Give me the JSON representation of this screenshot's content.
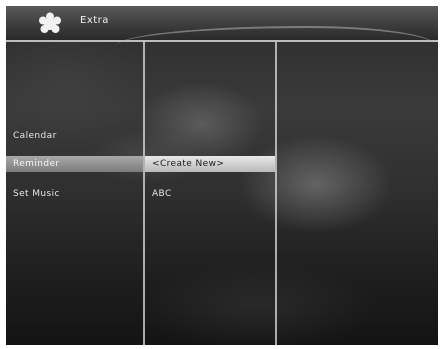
{
  "header": {
    "title": "Extra",
    "logo_icon": "flower-logo-icon"
  },
  "menu_column_1": {
    "items": [
      {
        "label": "Calendar",
        "selected": false
      },
      {
        "label": "Reminder",
        "selected": true
      },
      {
        "label": "Set Music",
        "selected": false
      }
    ]
  },
  "menu_column_2": {
    "items": [
      {
        "label": "<Create New>",
        "selected": true
      },
      {
        "label": "ABC",
        "selected": false
      }
    ]
  },
  "colors": {
    "header_bg": "#3d3d3d",
    "highlight": "#d6d6d6",
    "text": "#e6e6e6"
  }
}
